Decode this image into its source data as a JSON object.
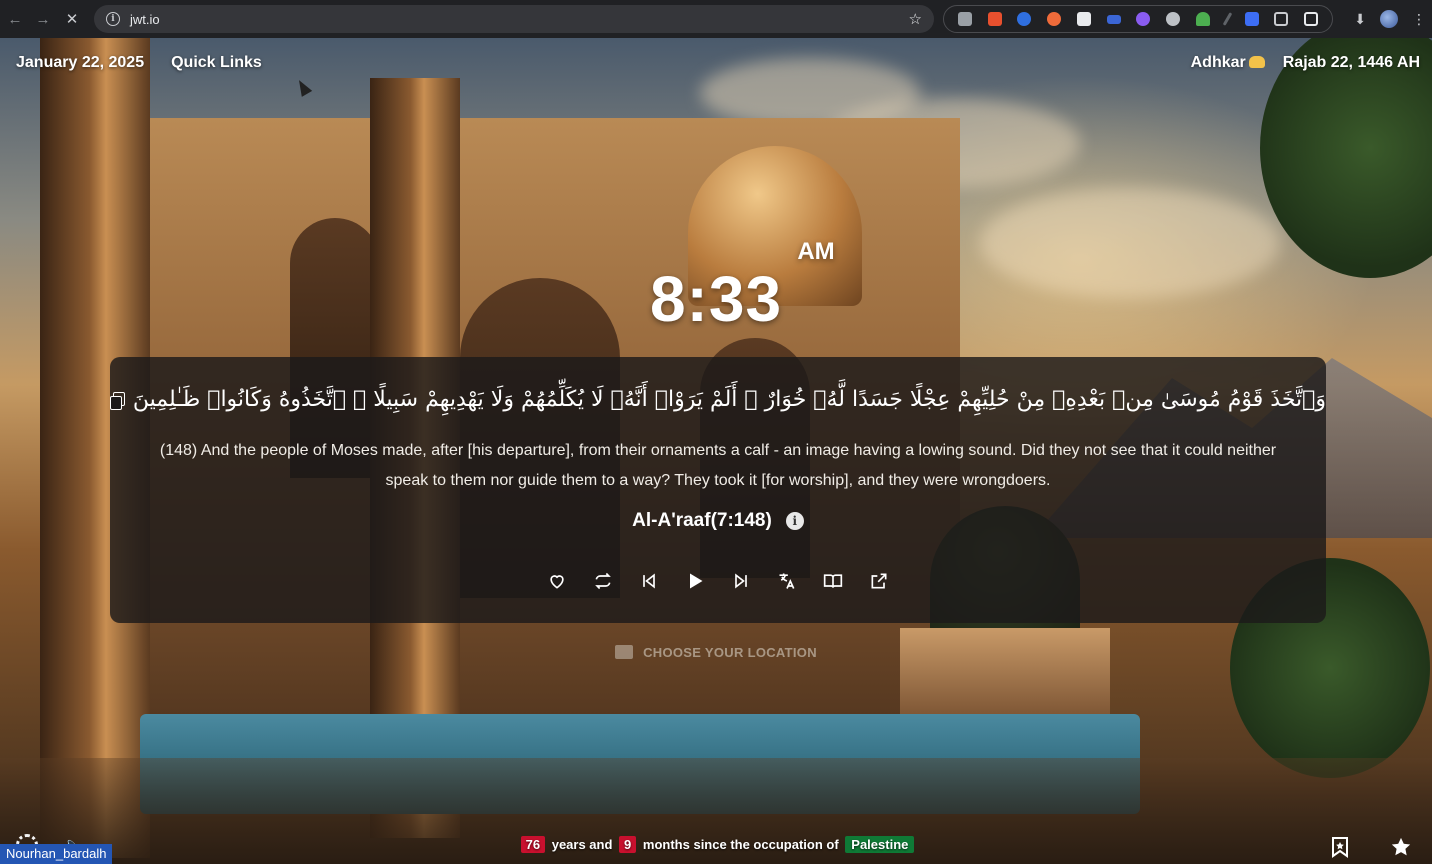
{
  "browser": {
    "url": "jwt.io"
  },
  "header": {
    "date": "January 22, 2025",
    "quick_links": "Quick Links",
    "adhkar": "Adhkar",
    "hijri_date": "Rajab 22, 1446 AH"
  },
  "clock": {
    "ampm": "AM",
    "time": "8:33"
  },
  "verse": {
    "arabic": "وَٱتَّخَذَ قَوْمُ مُوسَىٰ مِنۢ بَعْدِهِۦ مِنْ حُلِيِّهِمْ عِجْلًا جَسَدًا لَّهُۥ خُوَارٌ ۚ أَلَمْ يَرَوْا۟ أَنَّهُۥ لَا يُكَلِّمُهُمْ وَلَا يَهْدِيهِمْ سَبِيلًا ۘ ٱتَّخَذُوهُ وَكَانُوا۟ ظَـٰلِمِينَ",
    "translation": "(148) And the people of Moses made, after [his departure], from their ornaments a calf - an image having a lowing sound. Did they not see that it could neither speak to them nor guide them to a way? They took it [for worship], and they were wrongdoers.",
    "reference": "Al-A'raaf(7:148)"
  },
  "location": {
    "label": "CHOOSE YOUR LOCATION"
  },
  "footer": {
    "years": "76",
    "years_text": "years and",
    "months": "9",
    "months_text": "months since the occupation of",
    "place": "Palestine",
    "user": "Nourhan_bardalh"
  },
  "colors": {
    "badge_red": "#c8102e",
    "badge_green": "#0f7a36",
    "card_bg": "rgba(28,26,26,0.82)"
  },
  "icons": {
    "controls": [
      "heart-icon",
      "repeat-icon",
      "previous-icon",
      "play-icon",
      "next-icon",
      "translate-icon",
      "book-icon",
      "share-icon"
    ]
  }
}
